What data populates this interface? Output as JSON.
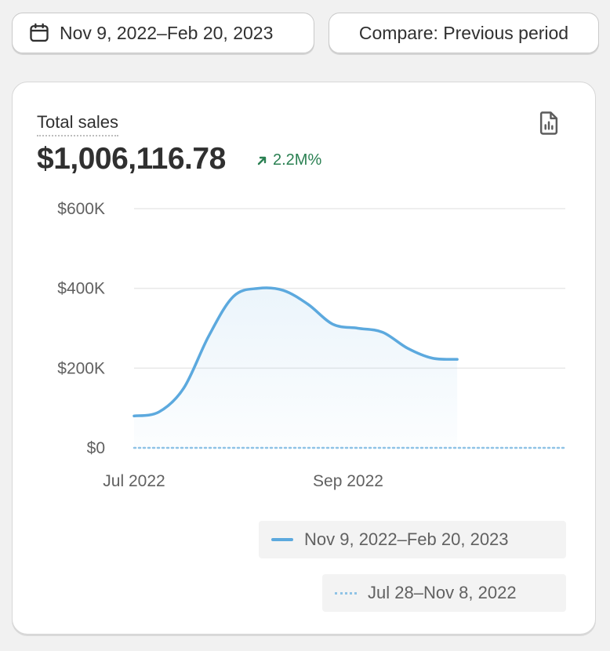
{
  "toolbar": {
    "date_range_label": "Nov 9, 2022–Feb 20, 2023",
    "compare_label": "Compare: Previous period",
    "calendar_icon": "calendar-icon"
  },
  "card": {
    "metric_label": "Total sales",
    "metric_value": "$1,006,116.78",
    "metric_change": "2.2M%",
    "change_direction": "up",
    "export_icon": "report-export-icon",
    "positive_color": "#2a8052",
    "series_color": "#5ca9de"
  },
  "chart_data": {
    "type": "area",
    "y_ticks": [
      "$0",
      "$200K",
      "$400K",
      "$600K"
    ],
    "ylim": [
      0,
      600000
    ],
    "x_tick_labels": [
      "Jul 2022",
      "Sep 2022"
    ],
    "grid": true,
    "legend_position": "bottom-right",
    "series": [
      {
        "name": "Nov 9, 2022–Feb 20, 2023",
        "style": "solid",
        "values": [
          80000,
          90000,
          150000,
          280000,
          380000,
          400000,
          395000,
          360000,
          310000,
          300000,
          290000,
          250000,
          225000,
          222000
        ]
      },
      {
        "name": "Jul 28–Nov 8, 2022",
        "style": "dotted",
        "values": [
          0,
          0,
          0,
          0,
          0,
          0,
          0,
          0,
          0,
          0,
          0,
          0,
          0,
          0,
          0,
          0,
          0,
          0
        ]
      }
    ]
  }
}
